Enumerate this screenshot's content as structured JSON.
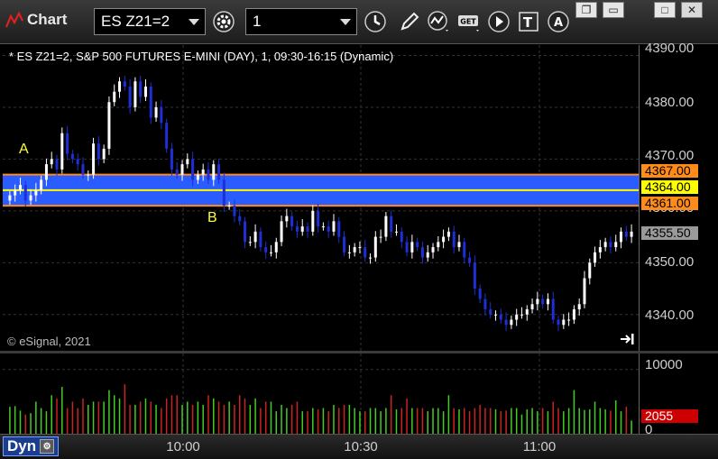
{
  "window": {
    "title": "Chart",
    "app_icon": "chart-app-icon"
  },
  "toolbar": {
    "symbol": "ES Z21=2",
    "interval": "1",
    "buttons": [
      "settings-gear-icon",
      "clock-icon",
      "pencil-draw-icon",
      "trend-curve-icon",
      "get-data-icon",
      "play-icon",
      "text-tool-icon",
      "alert-icon"
    ]
  },
  "window_controls": [
    "restore-icon",
    "minimize-icon",
    "maximize-icon",
    "close-icon"
  ],
  "chart": {
    "study_label": "* ES Z21=2, S&P 500 FUTURES E-MINI (DAY), 1, 09:30-16:15 (Dynamic)",
    "copyright": "© eSignal, 2021",
    "annotation_a": "A",
    "annotation_b": "B",
    "price_ticks": [
      "4390.00",
      "4380.00",
      "4370.00",
      "4360.00",
      "4350.00",
      "4340.00"
    ],
    "level_tags": {
      "upper": "4367.00",
      "middle": "4364.00",
      "lower": "4361.00",
      "last": "4355.50"
    },
    "volume_ticks": {
      "top": "10000",
      "bottom": "0",
      "current": "2055"
    },
    "time_ticks": [
      "10:00",
      "10:30",
      "11:00"
    ],
    "dynamic_label": "Dyn",
    "colors": {
      "up": "#ffffff",
      "down": "#1e2fd6",
      "zone": "#2a5cff",
      "upper_line": "#ff8c1a",
      "middle_line": "#ffff00",
      "vol_up": "#44cc22",
      "vol_down": "#cc2222"
    }
  },
  "chart_data": {
    "type": "candlestick",
    "title": "ES Z21=2, S&P 500 FUTURES E-MINI (DAY), 1, 09:30-16:15 (Dynamic)",
    "ylim": [
      4333,
      4392
    ],
    "levels": [
      4367.0,
      4364.0,
      4361.0
    ],
    "last_price": 4355.5,
    "series": [
      {
        "name": "ES Z21=2",
        "close": [
          4363,
          4364,
          4365,
          4362,
          4363,
          4364,
          4366,
          4369,
          4370,
          4368,
          4375,
          4371,
          4370,
          4369,
          4367,
          4367,
          4373,
          4370,
          4372,
          4381,
          4383,
          4385,
          4384,
          4380,
          4385,
          4382,
          4384,
          4378,
          4380,
          4377,
          4372,
          4368,
          4367,
          4369,
          4370,
          4366,
          4367,
          4368,
          4366,
          4369,
          4366,
          4361,
          4361,
          4359,
          4358,
          4354,
          4354,
          4356,
          4353,
          4352,
          4352,
          4354,
          4358,
          4359,
          4357,
          4356,
          4357,
          4356,
          4360,
          4357,
          4357,
          4356,
          4358,
          4355,
          4352,
          4352,
          4353,
          4353,
          4351,
          4351,
          4355,
          4355,
          4359,
          4356,
          4356,
          4354,
          4352,
          4354,
          4353,
          4351,
          4352,
          4353,
          4354,
          4355,
          4356,
          4353,
          4354,
          4351,
          4350,
          4345,
          4343,
          4341,
          4340,
          4340,
          4339,
          4338,
          4339,
          4340,
          4340,
          4341,
          4342,
          4343,
          4342,
          4343,
          4339,
          4338,
          4339,
          4339,
          4341,
          4342,
          4347,
          4350,
          4352,
          4353,
          4354,
          4353,
          4354,
          4356,
          4355,
          4356
        ]
      }
    ],
    "volume": [
      4200,
      4300,
      3600,
      3000,
      3200,
      5000,
      4000,
      3500,
      6000,
      5500,
      7300,
      4000,
      5000,
      4000,
      5500,
      4500,
      5000,
      5000,
      5000,
      6800,
      6000,
      5500,
      7700,
      4500,
      4500,
      5000,
      5500,
      5000,
      4500,
      4000,
      5500,
      6000,
      6000,
      4500,
      5000,
      4500,
      5000,
      4500,
      6000,
      5500,
      5000,
      4500,
      5000,
      4500,
      6000,
      5500,
      4500,
      5500,
      4000,
      5000,
      5000,
      3500,
      4500,
      4000,
      4500,
      5000,
      3500,
      3500,
      4000,
      3800,
      4000,
      3500,
      4500,
      4000,
      4500,
      4500,
      4000,
      3500,
      3500,
      4000,
      4000,
      3500,
      4000,
      6000,
      3800,
      4000,
      5500,
      4000,
      4000,
      4000,
      3500,
      4000,
      4000,
      3500,
      6000,
      4000,
      3800,
      4000,
      3500,
      4000,
      4500,
      4000,
      4000,
      3800,
      3500,
      3600,
      4000,
      4000,
      3000,
      3800,
      4000,
      3500,
      4000,
      3500,
      5000,
      4000,
      3500,
      4000,
      6800,
      4000,
      3700,
      3800,
      5000,
      4000,
      3800,
      3600,
      5200,
      3500,
      4200,
      2055
    ]
  }
}
